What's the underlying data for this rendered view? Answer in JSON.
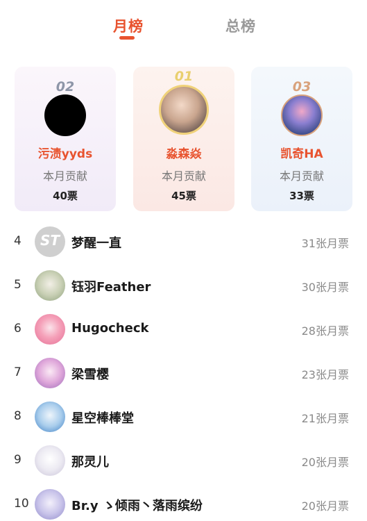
{
  "tabs": [
    {
      "label": "月榜",
      "active": true
    },
    {
      "label": "总榜",
      "active": false
    }
  ],
  "accent_color": "#e8532f",
  "podium": [
    {
      "rank_label": "02",
      "name": "污渍yyds",
      "label": "本月贡献",
      "votes": "40票",
      "avatar": "black-circle-avatar"
    },
    {
      "rank_label": "01",
      "name": "淼森焱",
      "label": "本月贡献",
      "votes": "45票",
      "avatar": "anime-character-avatar"
    },
    {
      "rank_label": "03",
      "name": "凯奇HA",
      "label": "本月贡献",
      "votes": "33票",
      "avatar": "illustrated-scene-avatar"
    }
  ],
  "list": [
    {
      "rank": "4",
      "name": "梦醒一直",
      "votes": "31张月票",
      "avatar_glyph": "ST"
    },
    {
      "rank": "5",
      "name": "钰羽Feather",
      "votes": "30张月票"
    },
    {
      "rank": "6",
      "name": "Hugocheck",
      "votes": "28张月票"
    },
    {
      "rank": "7",
      "name": "梁雪樱",
      "votes": "23张月票"
    },
    {
      "rank": "8",
      "name": "星空棒棒堂",
      "votes": "21张月票"
    },
    {
      "rank": "9",
      "name": "那灵儿",
      "votes": "20张月票"
    },
    {
      "rank": "10",
      "name": "Br.y ゝ倾雨丶落雨缤纷",
      "votes": "20张月票"
    }
  ]
}
